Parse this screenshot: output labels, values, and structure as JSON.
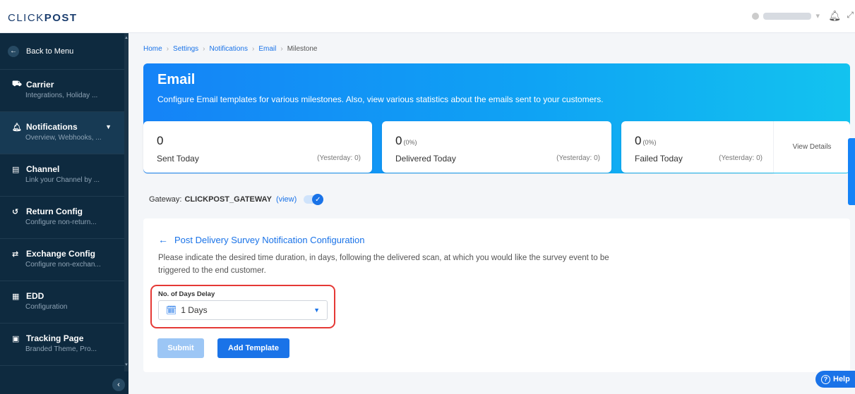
{
  "app": {
    "logo_light": "CLICK",
    "logo_bold": "POST"
  },
  "sidebar": {
    "back_label": "Back to Menu",
    "items": [
      {
        "title": "Carrier",
        "subtitle": "Integrations, Holiday ...",
        "icon": "carrier-icon"
      },
      {
        "title": "Notifications",
        "subtitle": "Overview, Webhooks, ...",
        "icon": "bell-icon",
        "active": true
      },
      {
        "title": "Channel",
        "subtitle": "Link your Channel by ...",
        "icon": "channel-icon"
      },
      {
        "title": "Return Config",
        "subtitle": "Configure non-return...",
        "icon": "return-icon"
      },
      {
        "title": "Exchange Config",
        "subtitle": "Configure non-exchan...",
        "icon": "exchange-icon"
      },
      {
        "title": "EDD",
        "subtitle": "Configuration",
        "icon": "calendar-icon"
      },
      {
        "title": "Tracking Page",
        "subtitle": "Branded Theme, Pro...",
        "icon": "tracking-page-icon"
      }
    ]
  },
  "breadcrumb": {
    "items": [
      "Home",
      "Settings",
      "Notifications",
      "Email"
    ],
    "current": "Milestone"
  },
  "banner": {
    "title": "Email",
    "description": "Configure Email templates for various milestones. Also, view various statistics about the emails sent to your customers."
  },
  "stats": [
    {
      "value": "0",
      "pct": "",
      "label": "Sent Today",
      "yesterday": "(Yesterday: 0)"
    },
    {
      "value": "0",
      "pct": "(0%)",
      "label": "Delivered Today",
      "yesterday": "(Yesterday: 0)"
    },
    {
      "value": "0",
      "pct": "(0%)",
      "label": "Failed Today",
      "yesterday": "(Yesterday: 0)"
    }
  ],
  "view_details": "View Details",
  "gateway": {
    "label": "Gateway:",
    "name": "CLICKPOST_GATEWAY",
    "view": "(view)",
    "enabled": true
  },
  "config": {
    "title": "Post Delivery Survey Notification Configuration",
    "description": "Please indicate the desired time duration, in days, following the delivered scan, at which you would like the survey event to be triggered to the end customer.",
    "field_label": "No. of Days Delay",
    "field_value": "1 Days",
    "submit": "Submit",
    "add_template": "Add Template"
  },
  "help": "Help",
  "colors": {
    "primary": "#1a73e8",
    "sidebar_bg": "#0e2a3f",
    "highlight": "#e53935"
  }
}
